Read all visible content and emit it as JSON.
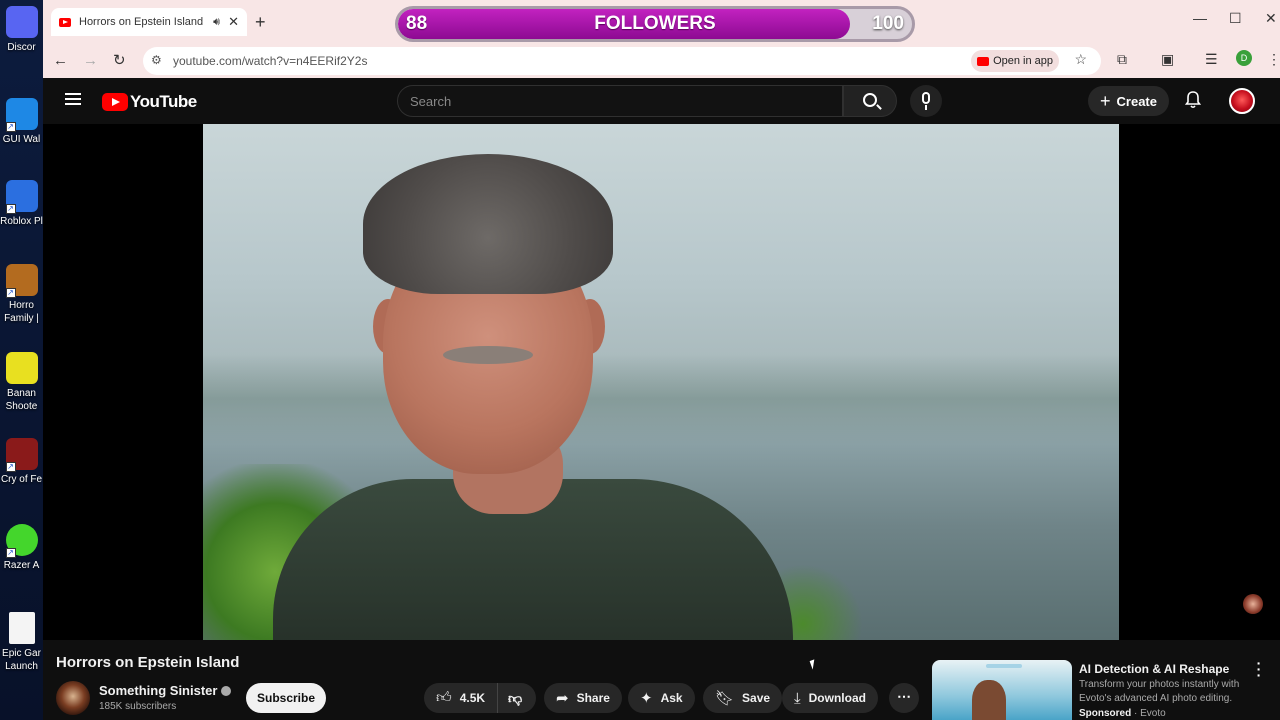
{
  "desktop": {
    "icons": [
      {
        "label": "Discor",
        "color": "#5865f2"
      },
      {
        "label": "GUI Wal",
        "color": "#1e88e5"
      },
      {
        "label": "Roblox Pl",
        "color": "#2b6fe0"
      },
      {
        "label": "Horro Family |",
        "color": "#b36b1f"
      },
      {
        "label": "Banan Shoote",
        "color": "#e8e020"
      },
      {
        "label": "Cry of Fe",
        "color": "#8a1a1a"
      },
      {
        "label": "Razer A",
        "color": "#44d62c"
      },
      {
        "label": "Epic Gar Launch",
        "color": "#f4f4f4"
      }
    ]
  },
  "browser": {
    "tab_title": "Horrors on Epstein Island -",
    "tab_sound_icon": "speaker-icon",
    "new_tab_label": "+",
    "url": "youtube.com/watch?v=n4EERif2Y2s",
    "open_in_app_label": "Open in app",
    "profile_initial": "D"
  },
  "followers_overlay": {
    "current": "88",
    "label": "FOLLOWERS",
    "goal": "100",
    "progress_fraction": 0.88,
    "fill_color": "#b11ab3"
  },
  "youtube": {
    "logo_text": "YouTube",
    "search_placeholder": "Search",
    "create_label": "Create",
    "video": {
      "title": "Horrors on Epstein Island",
      "channel": "Something Sinister",
      "subscribers": "185K subscribers",
      "subscribe_label": "Subscribe",
      "likes": "4.5K",
      "share_label": "Share",
      "ask_label": "Ask",
      "save_label": "Save",
      "download_label": "Download"
    },
    "ad": {
      "title": "AI Detection & AI Reshape",
      "description": "Transform your photos instantly with Evoto's advanced AI photo editing.",
      "sponsored": "Sponsored",
      "advertiser": "Evoto"
    }
  }
}
